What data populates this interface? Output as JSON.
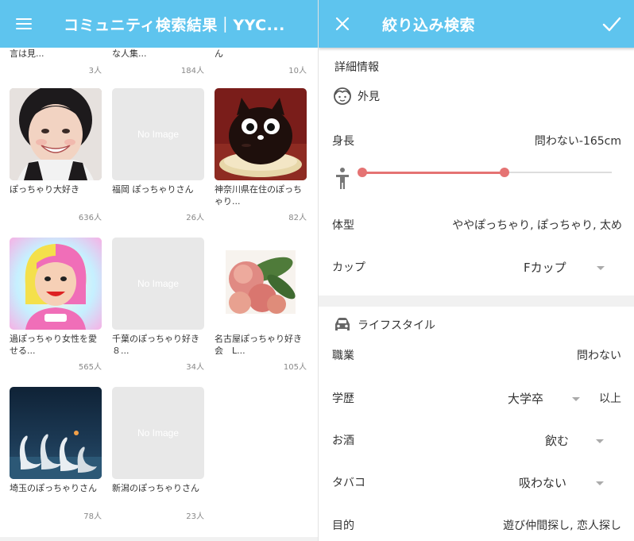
{
  "left": {
    "title": "コミュニティ検索結果｜YYC...",
    "top_row": [
      {
        "text": "言は見...",
        "count": "3人"
      },
      {
        "text": "な人集...",
        "count": "184人"
      },
      {
        "text": "ん",
        "count": "10人"
      }
    ],
    "no_image_label": "No Image",
    "cards": [
      {
        "name": "ぽっちゃり大好き",
        "count": "636人",
        "image": "photo-woman"
      },
      {
        "name": "福岡 ぽっちゃりさん",
        "count": "26人",
        "image": "no-image"
      },
      {
        "name": "神奈川県在住のぽっちゃり...",
        "count": "82人",
        "image": "cake-cat"
      },
      {
        "name": "過ぽっちゃり女性を愛せる...",
        "count": "565人",
        "image": "cartoon-woman"
      },
      {
        "name": "千葉のぽっちゃり好き　８...",
        "count": "34人",
        "image": "no-image"
      },
      {
        "name": "名古屋ぽっちゃり好き会　L...",
        "count": "105人",
        "image": "peaches"
      },
      {
        "name": "埼玉のぽっちゃりさん",
        "count": "78人",
        "image": "swans"
      },
      {
        "name": "新潟のぽっちゃりさん",
        "count": "23人",
        "image": "no-image"
      }
    ]
  },
  "right": {
    "title": "絞り込み検索",
    "section_detail": "詳細情報",
    "appearance_label": "外見",
    "height": {
      "label": "身長",
      "value": "問わない-165cm",
      "range_fraction": [
        0.0,
        0.57
      ]
    },
    "body_type": {
      "label": "体型",
      "value": "ややぽっちゃり, ぽっちゃり, 太め"
    },
    "cup": {
      "label": "カップ",
      "value": "Fカップ"
    },
    "lifestyle_label": "ライフスタイル",
    "occupation": {
      "label": "職業",
      "value": "問わない"
    },
    "education": {
      "label": "学歴",
      "value": "大学卒",
      "suffix": "以上"
    },
    "drinking": {
      "label": "お酒",
      "value": "飲む"
    },
    "smoking": {
      "label": "タバコ",
      "value": "吸わない"
    },
    "purpose": {
      "label": "目的",
      "value": "遊び仲間探し, 恋人探し"
    }
  },
  "colors": {
    "appbar": "#5ec4ee",
    "accent": "#e57373"
  }
}
